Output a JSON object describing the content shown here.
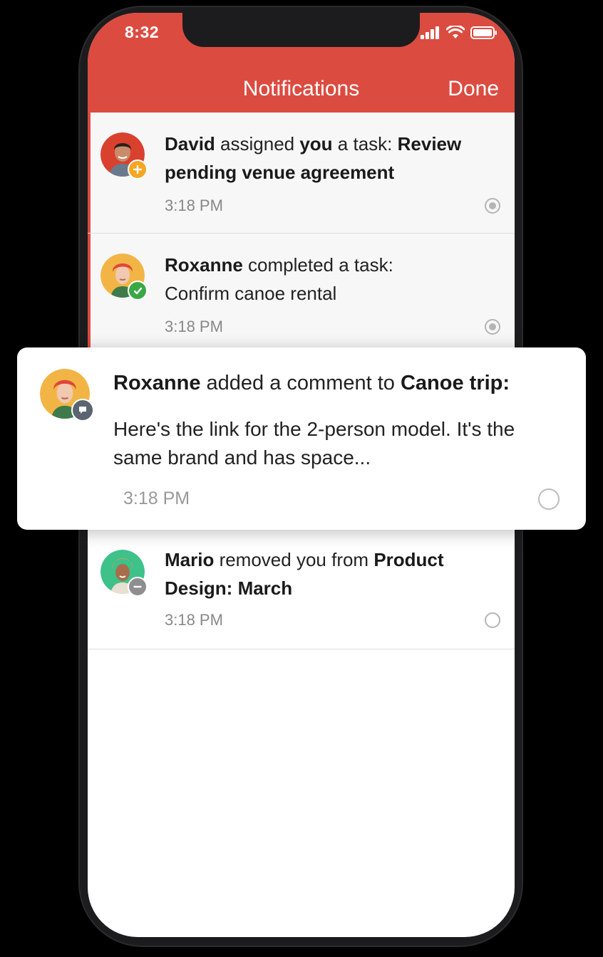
{
  "status_bar": {
    "time": "8:32"
  },
  "nav": {
    "title": "Notifications",
    "done_label": "Done"
  },
  "colors": {
    "brand_red": "#dc4b40",
    "assign_badge": "#f5a623",
    "complete_badge": "#3aa845",
    "comment_badge": "#5b6470",
    "remove_badge": "#8e8e8e"
  },
  "notifications": [
    {
      "actor": "David",
      "verb": " assigned ",
      "target": "you",
      "mid": " a task: ",
      "subject": "Review pending venue agreement",
      "time": "3:18 PM",
      "badge_icon": "plus-icon"
    },
    {
      "actor": "Roxanne",
      "verb": " completed a task:",
      "subject": "Confirm canoe rental",
      "time": "3:18 PM",
      "badge_icon": "check-icon"
    },
    {
      "actor": "Mario",
      "verb": " removed you from ",
      "subject": "Product Design: March",
      "time": "3:18 PM",
      "badge_icon": "minus-icon"
    }
  ],
  "comment_card": {
    "actor": "Roxanne",
    "verb": " added a comment to ",
    "subject": "Canoe trip:",
    "body": "Here's the link for the 2-person model. It's the same brand and has space...",
    "time": "3:18 PM",
    "badge_icon": "comment-icon"
  }
}
